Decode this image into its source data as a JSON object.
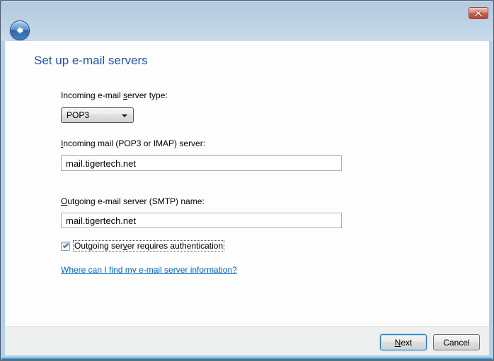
{
  "window": {
    "heading": "Set up e-mail servers"
  },
  "icons": {
    "close": "x-cross",
    "back": "left-arrow",
    "dropdown": "down-triangle",
    "checkmark": "check"
  },
  "form": {
    "server_type": {
      "label_pre": "Incoming e-mail ",
      "label_key": "s",
      "label_post": "erver type:",
      "value": "POP3"
    },
    "incoming_server": {
      "label_pre": "",
      "label_key": "I",
      "label_post": "ncoming mail (POP3 or IMAP) server:",
      "value": "mail.tigertech.net"
    },
    "outgoing_server": {
      "label_pre": "",
      "label_key": "O",
      "label_post": "utgoing e-mail server (SMTP) name:",
      "value": "mail.tigertech.net"
    },
    "auth_checkbox": {
      "label_pre": "Outgoing ser",
      "label_key": "v",
      "label_post": "er requires authentication",
      "checked": true
    },
    "help_link": "Where can I find my e-mail server information?"
  },
  "footer": {
    "next_pre": "",
    "next_key": "N",
    "next_post": "ext",
    "cancel_label": "Cancel"
  },
  "colors": {
    "heading_text": "#2353b5",
    "link": "#0066cc",
    "header_gradient_top": "#b2c8de",
    "header_gradient_bottom": "#c9dbec",
    "body_bg": "#fdfdfd",
    "footer_bg": "#eef0f0",
    "close_button_red": "#cd604d",
    "back_button_blue": "#2b66aa",
    "bottom_accent_cyan": "#2cb0d8",
    "default_button_border": "#2c7fb5"
  }
}
